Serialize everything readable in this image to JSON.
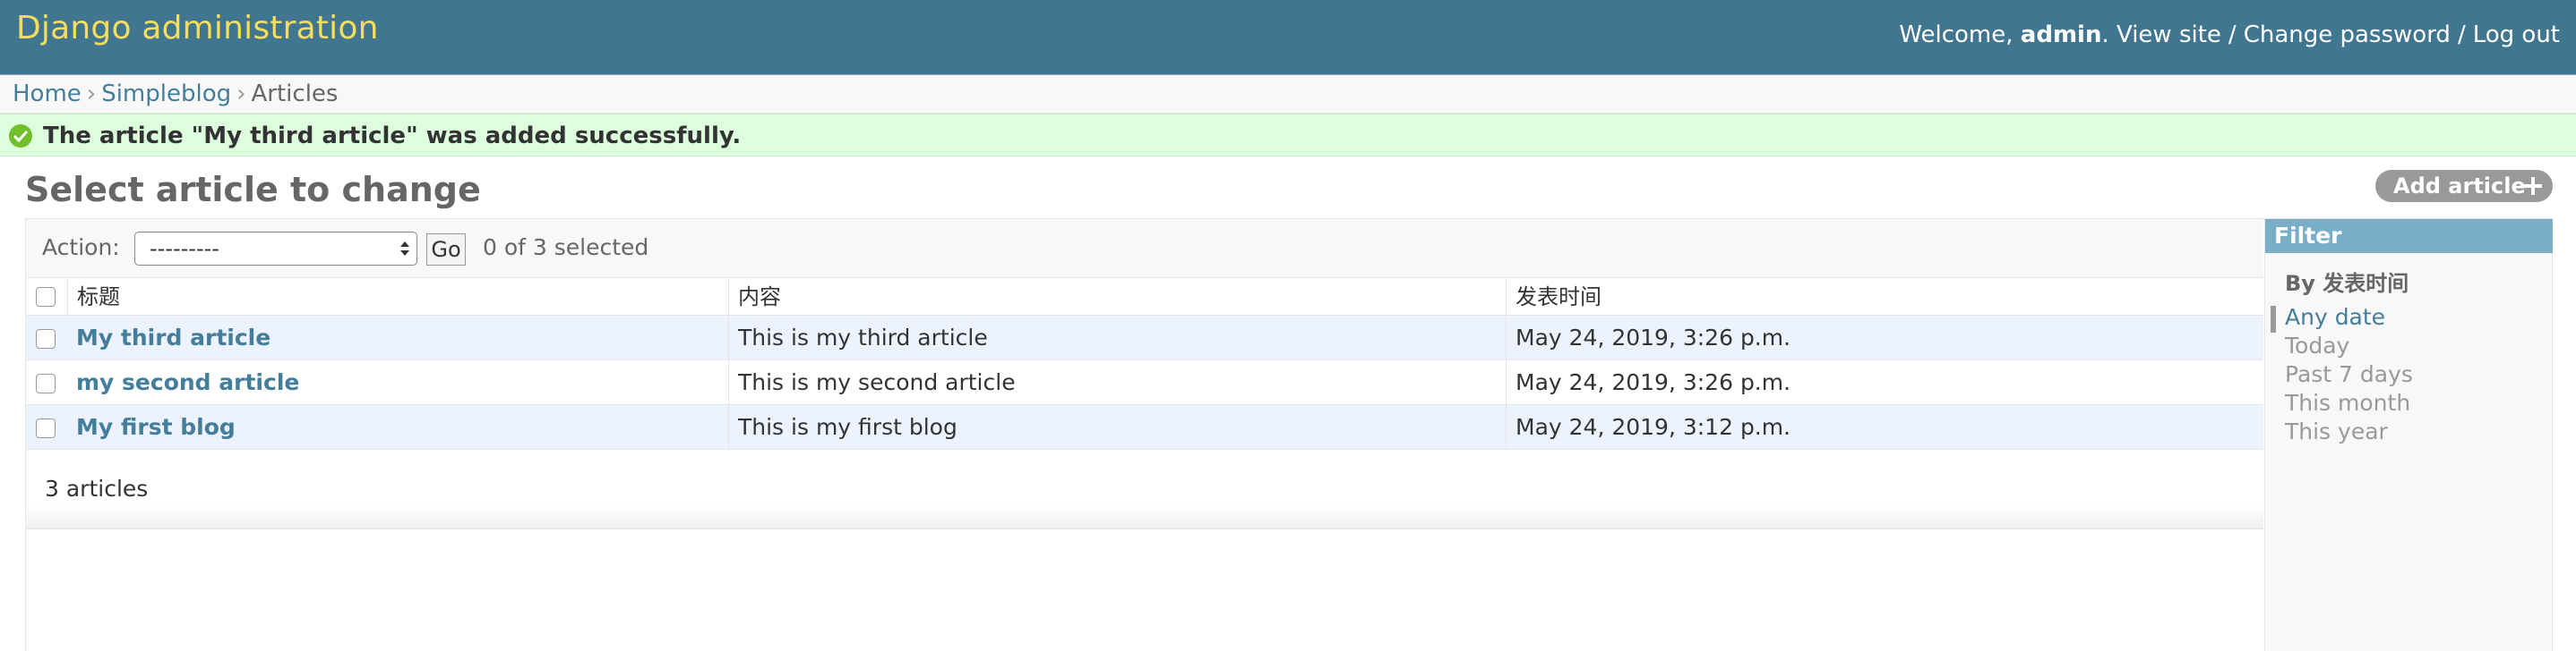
{
  "header": {
    "site_name": "Django administration",
    "welcome_text": "Welcome, ",
    "username": "admin",
    "period": ". ",
    "links": [
      "View site",
      "Change password",
      "Log out"
    ],
    "separator": "/"
  },
  "breadcrumbs": {
    "items": [
      "Home",
      "Simpleblog"
    ],
    "current": "Articles",
    "separator": "›"
  },
  "message": {
    "text": "The article \"My third article\" was added successfully."
  },
  "page": {
    "title": "Select article to change",
    "add_button": "Add article"
  },
  "actions": {
    "label": "Action:",
    "selected_option": "---------",
    "go_label": "Go",
    "counter": "0 of 3 selected"
  },
  "table": {
    "headers": [
      "标题",
      "内容",
      "发表时间"
    ],
    "rows": [
      {
        "title": "My third article",
        "content": "This is my third article",
        "time": "May 24, 2019, 3:26 p.m."
      },
      {
        "title": "my second article",
        "content": "This is my second article",
        "time": "May 24, 2019, 3:26 p.m."
      },
      {
        "title": "My first blog",
        "content": "This is my first blog",
        "time": "May 24, 2019, 3:12 p.m."
      }
    ]
  },
  "paginator": {
    "text": "3 articles"
  },
  "filter": {
    "title": "Filter",
    "subtitle": "By 发表时间",
    "options": [
      "Any date",
      "Today",
      "Past 7 days",
      "This month",
      "This year"
    ],
    "selected": "Any date"
  },
  "colors": {
    "header_bg": "#417690",
    "site_name": "#f5dd5d",
    "link": "#447e9b",
    "success_bg": "#ddffdd",
    "row_alt": "#edf3fe",
    "filter_header": "#79aec8"
  }
}
